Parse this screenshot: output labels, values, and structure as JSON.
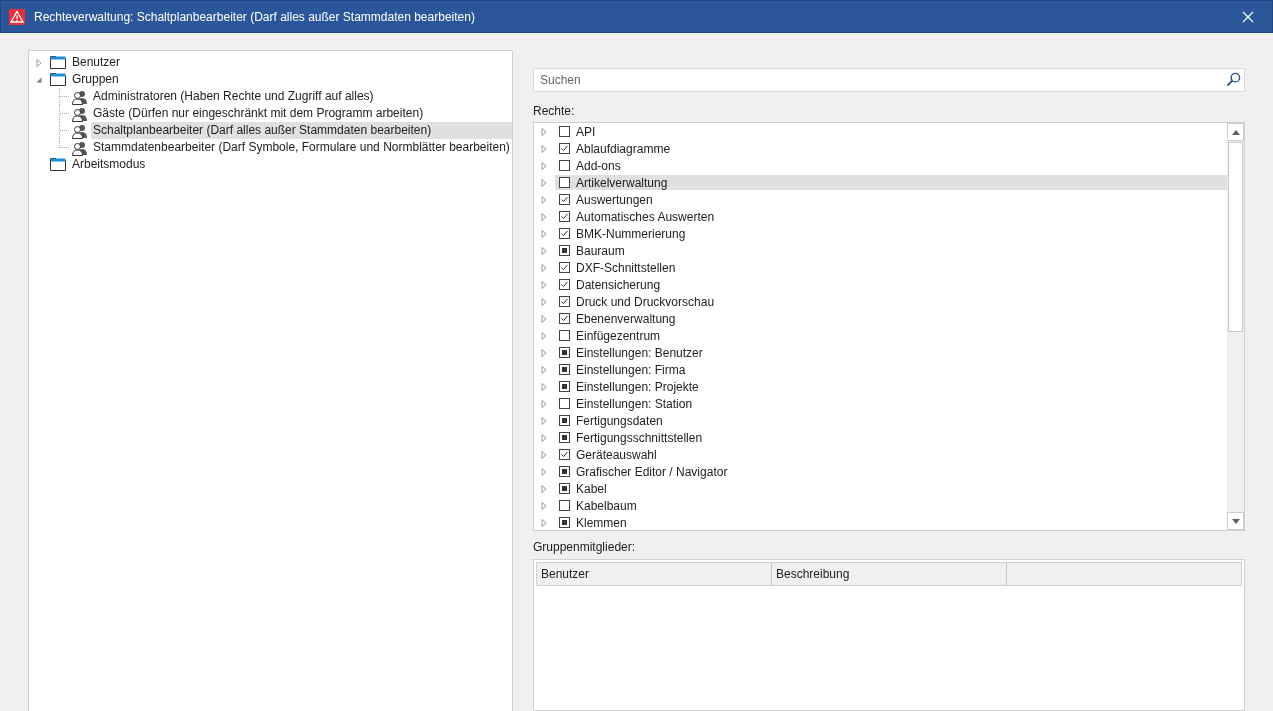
{
  "window": {
    "title": "Rechteverwaltung: Schaltplanbearbeiter (Darf alles außer Stammdaten bearbeiten)"
  },
  "tree": [
    {
      "label": "Benutzer",
      "expanded": false,
      "selected": false
    },
    {
      "label": "Gruppen",
      "expanded": true,
      "selected": false,
      "children": [
        {
          "label": "Administratoren (Haben Rechte und Zugriff auf alles)",
          "selected": false
        },
        {
          "label": "Gäste (Dürfen nur eingeschränkt mit dem Programm arbeiten)",
          "selected": false
        },
        {
          "label": "Schaltplanbearbeiter (Darf alles außer Stammdaten bearbeiten)",
          "selected": true
        },
        {
          "label": "Stammdatenbearbeiter (Darf Symbole, Formulare und Normblätter bearbeiten)",
          "selected": false
        }
      ]
    },
    {
      "label": "Arbeitsmodus",
      "selected": false
    }
  ],
  "search": {
    "placeholder": "Suchen"
  },
  "rights_label": "Rechte:",
  "rights": [
    {
      "label": "API",
      "checked": false,
      "partial": false,
      "selected": false
    },
    {
      "label": "Ablaufdiagramme",
      "checked": true,
      "partial": false,
      "selected": false
    },
    {
      "label": "Add-ons",
      "checked": false,
      "partial": false,
      "selected": false
    },
    {
      "label": "Artikelverwaltung",
      "checked": false,
      "partial": false,
      "selected": true
    },
    {
      "label": "Auswertungen",
      "checked": true,
      "partial": false,
      "selected": false
    },
    {
      "label": "Automatisches Auswerten",
      "checked": true,
      "partial": false,
      "selected": false
    },
    {
      "label": "BMK-Nummerierung",
      "checked": true,
      "partial": false,
      "selected": false
    },
    {
      "label": "Bauraum",
      "partial": true,
      "selected": false
    },
    {
      "label": "DXF-Schnittstellen",
      "checked": true,
      "partial": false,
      "selected": false
    },
    {
      "label": "Datensicherung",
      "checked": true,
      "partial": false,
      "selected": false
    },
    {
      "label": "Druck und Druckvorschau",
      "checked": true,
      "partial": false,
      "selected": false
    },
    {
      "label": "Ebenenverwaltung",
      "checked": true,
      "partial": false,
      "selected": false
    },
    {
      "label": "Einfügezentrum",
      "checked": false,
      "partial": false,
      "selected": false
    },
    {
      "label": "Einstellungen: Benutzer",
      "partial": true,
      "selected": false
    },
    {
      "label": "Einstellungen: Firma",
      "partial": true,
      "selected": false
    },
    {
      "label": "Einstellungen: Projekte",
      "partial": true,
      "selected": false
    },
    {
      "label": "Einstellungen: Station",
      "checked": false,
      "partial": false,
      "selected": false
    },
    {
      "label": "Fertigungsdaten",
      "partial": true,
      "selected": false
    },
    {
      "label": "Fertigungsschnittstellen",
      "partial": true,
      "selected": false
    },
    {
      "label": "Geräteauswahl",
      "checked": true,
      "partial": false,
      "selected": false
    },
    {
      "label": "Grafischer Editor / Navigator",
      "partial": true,
      "selected": false
    },
    {
      "label": "Kabel",
      "partial": true,
      "selected": false
    },
    {
      "label": "Kabelbaum",
      "checked": false,
      "partial": false,
      "selected": false
    },
    {
      "label": "Klemmen",
      "partial": true,
      "selected": false
    }
  ],
  "members_label": "Gruppenmitglieder:",
  "members_table": {
    "columns": [
      "Benutzer",
      "Beschreibung"
    ]
  }
}
